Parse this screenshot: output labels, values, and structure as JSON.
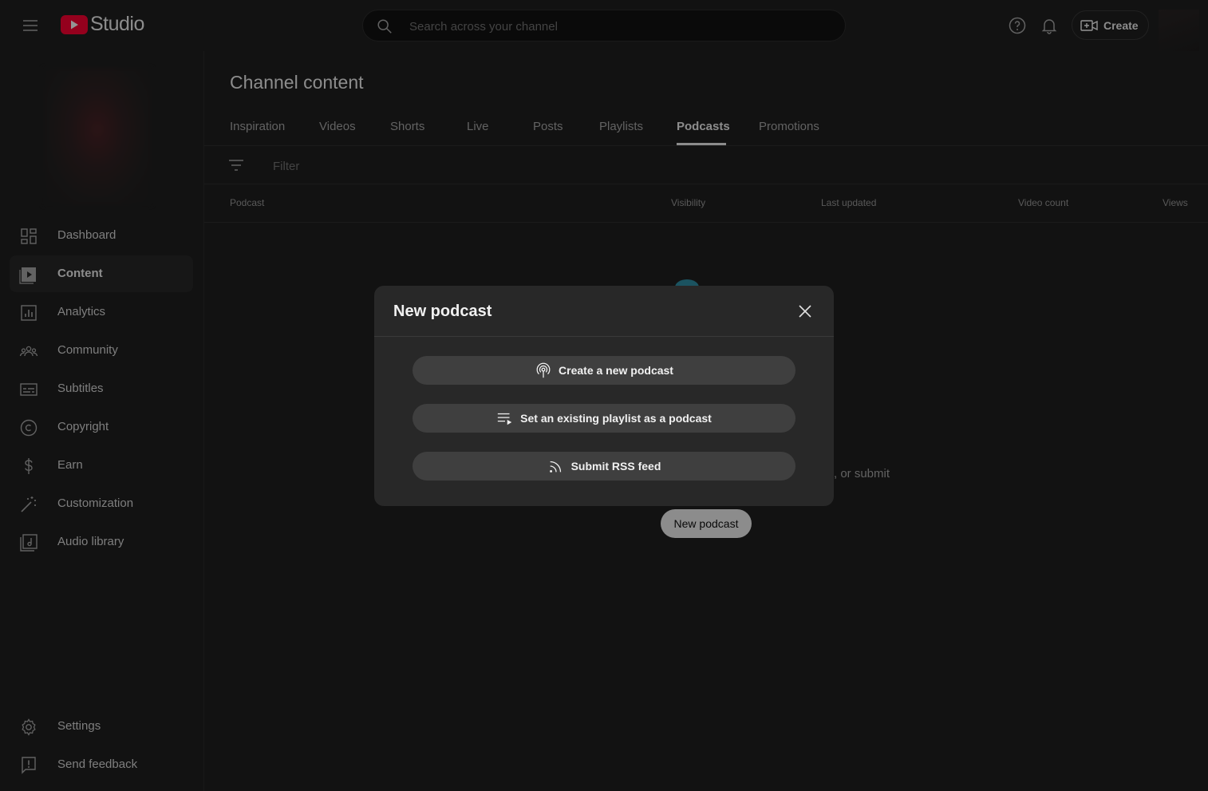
{
  "app": {
    "logo_text": "Studio"
  },
  "colors": {
    "brand_red": "#ff0033",
    "background": "#1f1f1f",
    "modal_bg": "#282828",
    "button_bg": "#3f3f3f"
  },
  "search": {
    "placeholder": "Search across your channel"
  },
  "header": {
    "create_label": "Create"
  },
  "page": {
    "title": "Channel content"
  },
  "tabs": [
    {
      "label": "Inspiration"
    },
    {
      "label": "Videos"
    },
    {
      "label": "Shorts"
    },
    {
      "label": "Live"
    },
    {
      "label": "Posts"
    },
    {
      "label": "Playlists"
    },
    {
      "label": "Podcasts",
      "active": true
    },
    {
      "label": "Promotions"
    }
  ],
  "filter": {
    "placeholder": "Filter"
  },
  "table": {
    "columns": [
      "Podcast",
      "Visibility",
      "Last updated",
      "Video count",
      "Views"
    ]
  },
  "sidebar": {
    "items": [
      {
        "label": "Dashboard",
        "icon": "dashboard-icon"
      },
      {
        "label": "Content",
        "icon": "content-icon",
        "active": true
      },
      {
        "label": "Analytics",
        "icon": "analytics-icon"
      },
      {
        "label": "Community",
        "icon": "community-icon"
      },
      {
        "label": "Subtitles",
        "icon": "subtitles-icon"
      },
      {
        "label": "Copyright",
        "icon": "copyright-icon"
      },
      {
        "label": "Earn",
        "icon": "dollar-icon"
      },
      {
        "label": "Customization",
        "icon": "magic-wand-icon"
      },
      {
        "label": "Audio library",
        "icon": "audio-library-icon"
      }
    ],
    "footer": [
      {
        "label": "Settings",
        "icon": "gear-icon"
      },
      {
        "label": "Send feedback",
        "icon": "feedback-icon"
      }
    ]
  },
  "empty_state": {
    "partial_text": ", or submit",
    "button_label": "New podcast"
  },
  "modal": {
    "title": "New podcast",
    "options": [
      {
        "label": "Create a new podcast",
        "icon": "podcast-icon"
      },
      {
        "label": "Set an existing playlist as a podcast",
        "icon": "playlist-add-icon"
      },
      {
        "label": "Submit RSS feed",
        "icon": "rss-icon"
      }
    ]
  }
}
